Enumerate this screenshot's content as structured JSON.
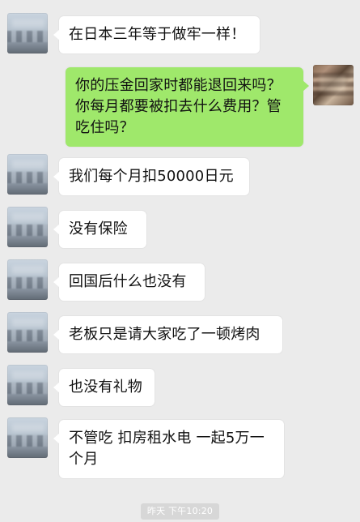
{
  "messages": [
    {
      "side": "left",
      "text": "在日本三年等于做牢一样！"
    },
    {
      "side": "right",
      "text": "你的压金回家时都能退回来吗？你每月都要被扣去什么费用？管吃住吗？"
    },
    {
      "side": "left",
      "text": "我们每个月扣50000日元"
    },
    {
      "side": "left",
      "text": "没有保险"
    },
    {
      "side": "left",
      "text": "回国后什么也没有"
    },
    {
      "side": "left",
      "text": "老板只是请大家吃了一顿烤肉"
    },
    {
      "side": "left",
      "text": "也没有礼物"
    },
    {
      "side": "left",
      "text": "不管吃 扣房租水电 一起5万一个月"
    }
  ],
  "timestamp": "昨天 下午10:20"
}
